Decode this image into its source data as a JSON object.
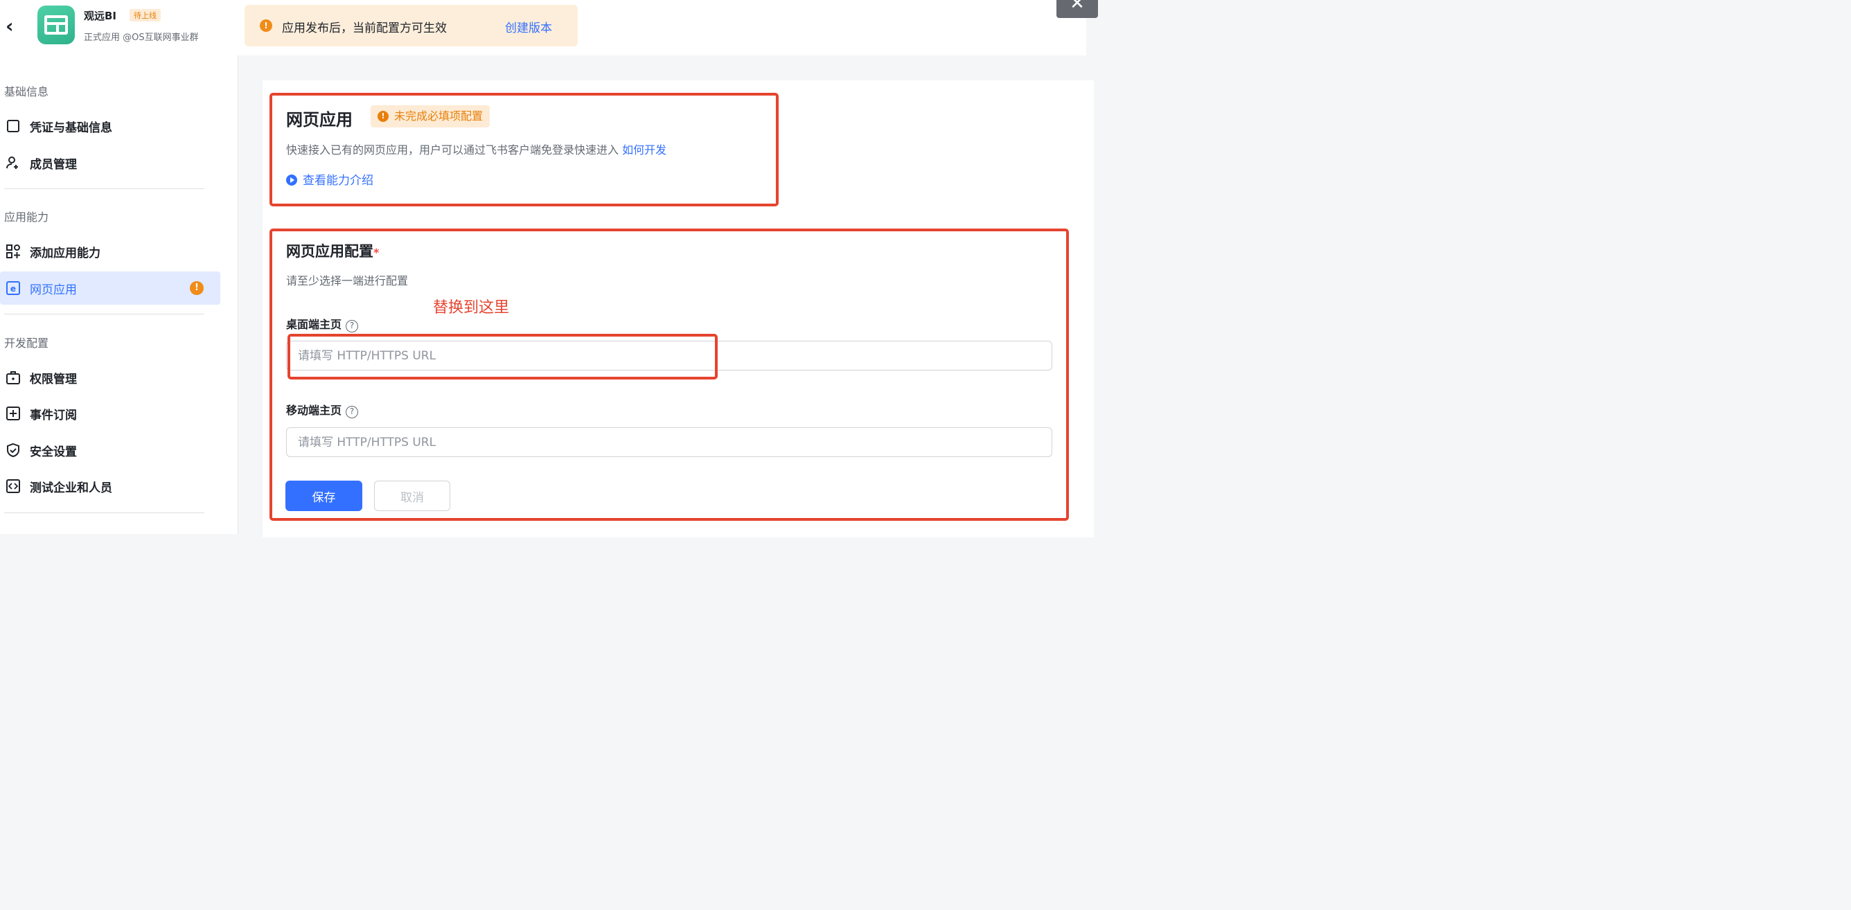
{
  "header": {
    "back_icon": "chevron-left-icon",
    "app_name": "观远BI",
    "app_status": "待上线",
    "app_subtitle": "正式应用 @OS互联网事业群",
    "notice_text": "应用发布后，当前配置方可生效",
    "notice_link": "创建版本",
    "close_label": "✕"
  },
  "sidebar": {
    "sections": [
      {
        "title": "基础信息"
      },
      {
        "title": "应用能力"
      },
      {
        "title": "开发配置"
      }
    ],
    "items": [
      {
        "label": "凭证与基础信息",
        "icon": "credential-icon"
      },
      {
        "label": "成员管理",
        "icon": "add-member-icon"
      },
      {
        "label": "添加应用能力",
        "icon": "apps-add-icon"
      },
      {
        "label": "网页应用",
        "icon": "web-app-icon",
        "active": true,
        "warning": "!"
      },
      {
        "label": "权限管理",
        "icon": "permission-icon"
      },
      {
        "label": "事件订阅",
        "icon": "event-icon"
      },
      {
        "label": "安全设置",
        "icon": "shield-check-icon"
      },
      {
        "label": "测试企业和人员",
        "icon": "test-icon"
      }
    ]
  },
  "web_app": {
    "title": "网页应用",
    "status_tag": "未完成必填项配置",
    "description": "快速接入已有的网页应用，用户可以通过飞书客户端免登录快速进入",
    "how_to_link": "如何开发",
    "intro_link": "查看能力介绍"
  },
  "config": {
    "title": "网页应用配置",
    "required_mark": "*",
    "subtitle": "请至少选择一端进行配置",
    "annotation": "替换到这里",
    "desktop_label": "桌面端主页",
    "desktop_placeholder": "请填写 HTTP/HTTPS URL",
    "desktop_value": "",
    "mobile_label": "移动端主页",
    "mobile_placeholder": "请填写 HTTP/HTTPS URL",
    "mobile_value": "",
    "help_icon": "question-circle-icon",
    "save_label": "保存",
    "cancel_label": "取消"
  },
  "colors": {
    "accent": "#3370ff",
    "warning": "#f08c1a",
    "annotation_red": "#e5442f"
  }
}
